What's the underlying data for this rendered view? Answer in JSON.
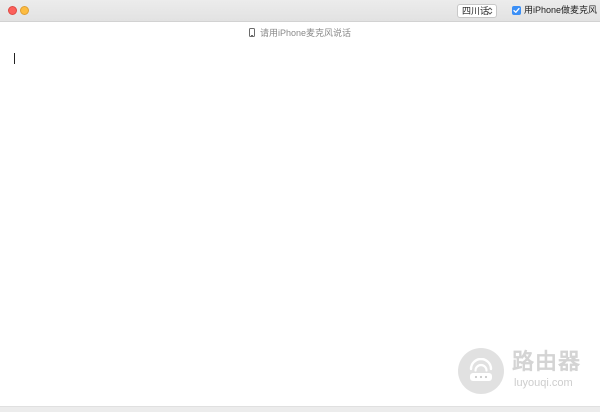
{
  "window": {
    "buttons": [
      "close",
      "minimize"
    ]
  },
  "toolbar": {
    "dialect_select": {
      "value": "四川话",
      "icon": "chevron-up-down-icon"
    },
    "use_iphone_mic": {
      "checked": true,
      "label": "用iPhone做麦克风"
    }
  },
  "hint": {
    "icon": "iphone-icon",
    "text": "请用iPhone麦克风说话"
  },
  "editor": {
    "text": ""
  },
  "watermark": {
    "title": "路由器",
    "subtitle": "luyouqi.com"
  },
  "colors": {
    "close": "#fc605b",
    "minimize": "#fdbc40",
    "checkbox_accent": "#3b8ff6",
    "hint_text": "#8a8a8a"
  }
}
